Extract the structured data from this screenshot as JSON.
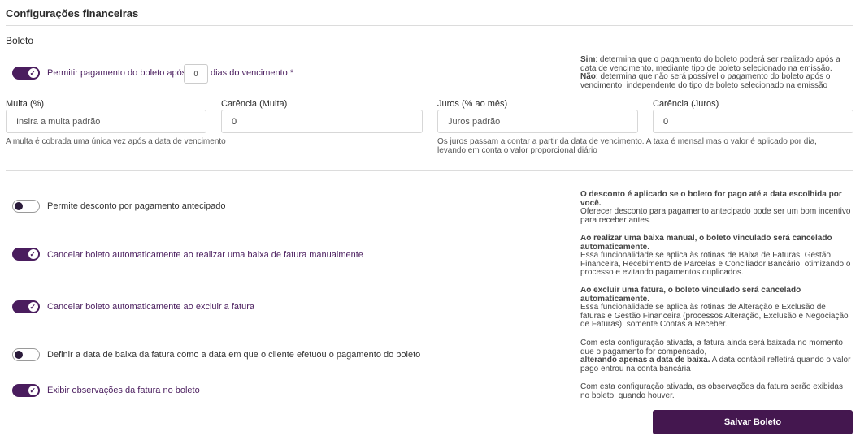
{
  "page": {
    "title": "Configurações financeiras"
  },
  "boleto": {
    "section_title": "Boleto",
    "allow_late": {
      "label_before": "Permitir pagamento do boleto após",
      "days_value": "0",
      "label_after": "dias do vencimento *",
      "enabled": true
    },
    "late_info": {
      "sim_label": "Sim",
      "sim_text": ": determina que o pagamento do boleto poderá ser realizado após a data de vencimento, mediante tipo de boleto selecionado na emissão.",
      "nao_label": "Não",
      "nao_text": ": determina que não será possível o pagamento do boleto após o vencimento, independente do tipo de boleto selecionado na emissão"
    },
    "fields": {
      "multa": {
        "label": "Multa (%)",
        "placeholder": "Insira a multa padrão",
        "value": ""
      },
      "carencia_multa": {
        "label": "Carência (Multa)",
        "placeholder": "",
        "value": "0"
      },
      "juros": {
        "label": "Juros (% ao mês)",
        "placeholder": "Juros padrão",
        "value": ""
      },
      "carencia_juros": {
        "label": "Carência (Juros)",
        "placeholder": "",
        "value": "0"
      }
    },
    "multa_help": "A multa é cobrada uma única vez após a data de vencimento",
    "juros_help": "Os juros passam a contar a partir da data de vencimento. A taxa é mensal mas o valor é aplicado por dia, levando em conta o valor proporcional diário"
  },
  "options": [
    {
      "label": "Permite desconto por pagamento antecipado",
      "enabled": false,
      "info_bold": "O desconto é aplicado se o boleto for pago até a data escolhida por você.",
      "info_text": "Oferecer desconto para pagamento antecipado pode ser um bom incentivo para receber antes."
    },
    {
      "label": "Cancelar boleto automaticamente ao realizar uma baixa de fatura manualmente",
      "enabled": true,
      "info_bold": "Ao realizar uma baixa manual, o boleto vinculado será cancelado automaticamente.",
      "info_text": "Essa funcionalidade se aplica às rotinas de Baixa de Faturas, Gestão Financeira, Recebimento de Parcelas e Conciliador Bancário, otimizando o processo e evitando pagamentos duplicados."
    },
    {
      "label": "Cancelar boleto automaticamente ao excluir a fatura",
      "enabled": true,
      "info_bold": "Ao excluir uma fatura, o boleto vinculado será cancelado automaticamente.",
      "info_text": "Essa funcionalidade se aplica às rotinas de Alteração e Exclusão de faturas e Gestão Financeira (processos Alteração, Exclusão e Negociação de Faturas), somente Contas a Receber."
    },
    {
      "label": "Definir a data de baixa da fatura como a data em que o cliente efetuou o pagamento do boleto",
      "enabled": false,
      "info_pre": "Com esta configuração ativada, a fatura ainda será baixada no momento que o pagamento for compensado,",
      "info_bold": "alterando apenas a data de baixa.",
      "info_post": "A data contábil refletirá quando o valor pago entrou na conta bancária"
    },
    {
      "label": "Exibir observações da fatura no boleto",
      "enabled": true,
      "info_text": "Com esta configuração ativada, as observações da fatura serão exibidas no boleto, quando houver."
    }
  ],
  "save_button": "Salvar Boleto",
  "colors": {
    "accent": "#44174f",
    "label_active": "#4a1d5e"
  }
}
